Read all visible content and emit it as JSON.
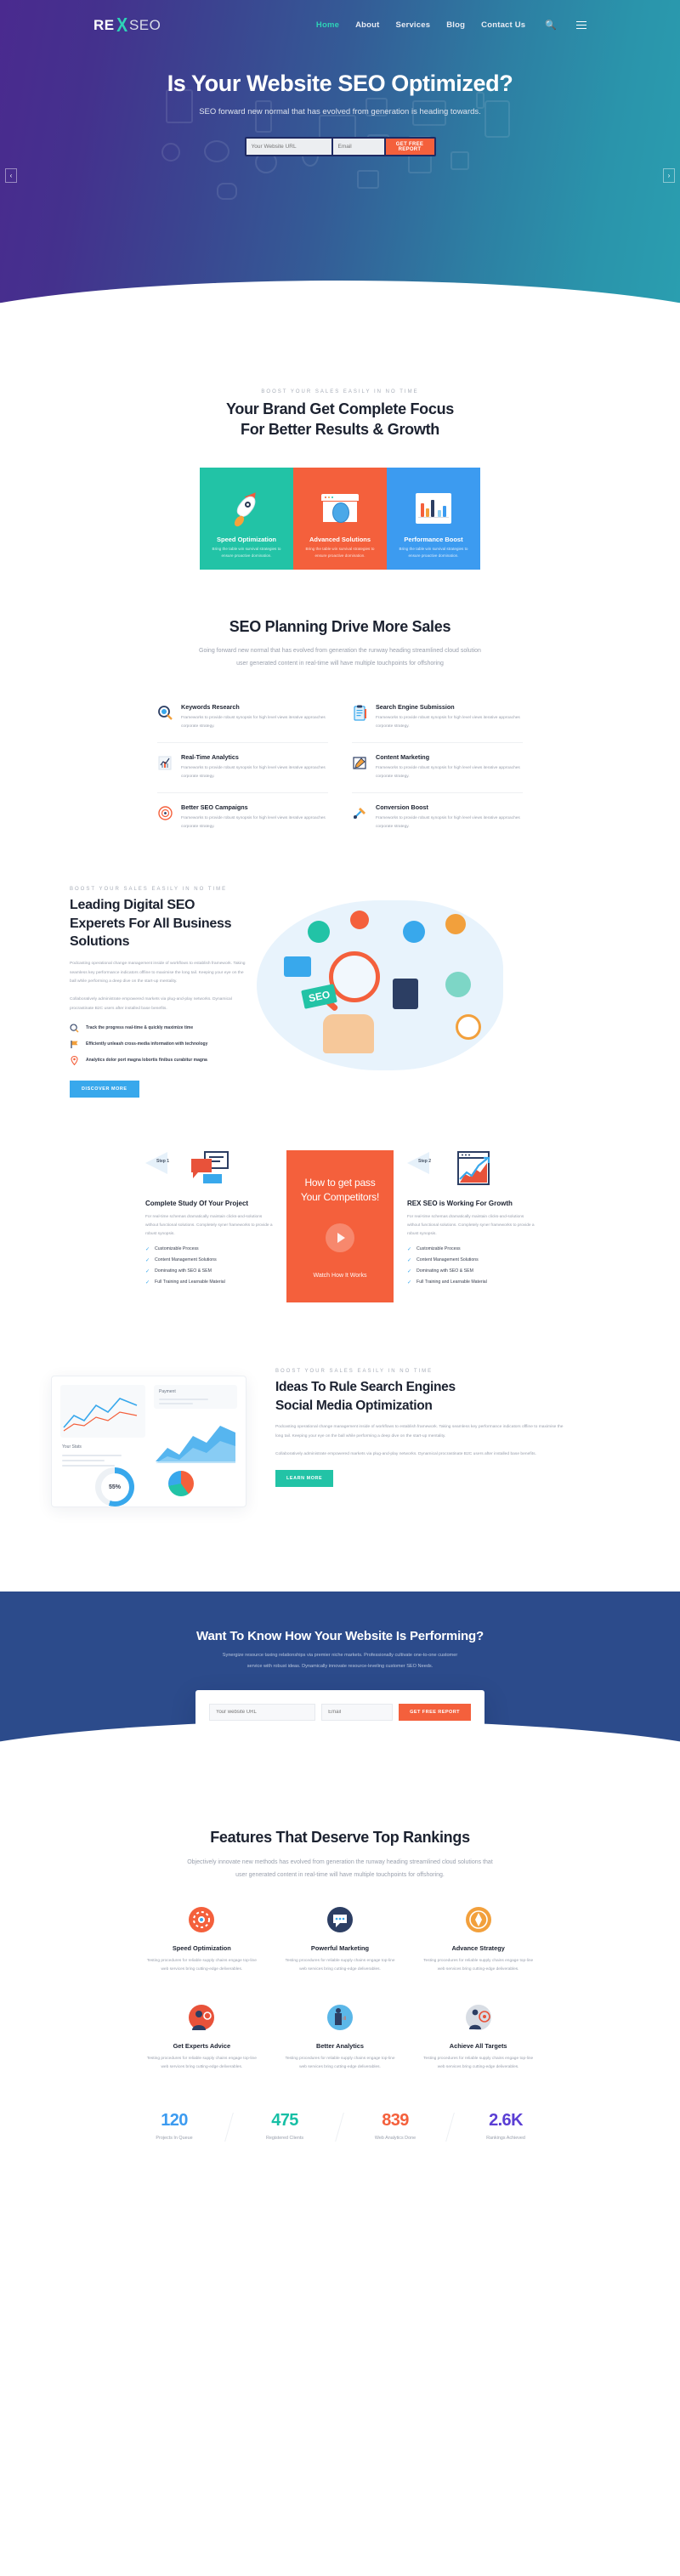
{
  "brand": {
    "re": "RE",
    "x": "X",
    "seo": "SEO"
  },
  "nav": {
    "items": [
      {
        "label": "Home",
        "active": true
      },
      {
        "label": "About",
        "active": false
      },
      {
        "label": "Services",
        "active": false
      },
      {
        "label": "Blog",
        "active": false
      },
      {
        "label": "Contact Us",
        "active": false
      }
    ],
    "search_icon": "search-icon",
    "menu_icon": "hamburger-icon"
  },
  "hero": {
    "title": "Is Your Website SEO Optimized?",
    "subtitle": "SEO forward new normal that has evolved from generation is heading towards.",
    "url_placeholder": "Your Website URL",
    "email_placeholder": "Email",
    "button": "GET FREE REPORT",
    "prev": "‹",
    "next": "›"
  },
  "focus": {
    "eyebrow": "BOOST YOUR SALES EASILY IN NO TIME",
    "title_line1": "Your Brand Get Complete Focus",
    "title_line2": "For Better Results & Growth",
    "cards": [
      {
        "title": "Speed Optimization",
        "desc": "Bring the table win survival strategies to ensure proactive domination.",
        "color": "#22c3a6"
      },
      {
        "title": "Advanced Solutions",
        "desc": "Bring the table win survival strategies to ensure proactive domination.",
        "color": "#f4603c"
      },
      {
        "title": "Performance Boost",
        "desc": "Bring the table win survival strategies to ensure proactive domination.",
        "color": "#3c9bf0"
      }
    ]
  },
  "planning": {
    "title": "SEO Planning Drive More Sales",
    "desc_line1": "Going forward new normal that has evolved from generation the runway heading streamlined cloud solution",
    "desc_line2": "user generated content in real-time will have multiple touchpoints for offshoring",
    "items": [
      {
        "title": "Keywords Research",
        "desc": "Frameworks to provide robust synopsis for high level views iterative approaches corporate strategy."
      },
      {
        "title": "Search Engine Submission",
        "desc": "Frameworks to provide robust synopsis for high level views iterative approaches corporate strategy."
      },
      {
        "title": "Real-Time Analytics",
        "desc": "Frameworks to provide robust synopsis for high level views iterative approaches corporate strategy."
      },
      {
        "title": "Content Marketing",
        "desc": "Frameworks to provide robust synopsis for high level views iterative approaches corporate strategy."
      },
      {
        "title": "Better SEO Campaigns",
        "desc": "Frameworks to provide robust synopsis for high level views iterative approaches corporate strategy."
      },
      {
        "title": "Conversion Boost",
        "desc": "Frameworks to provide robust synopsis for high level views iterative approaches corporate strategy."
      }
    ]
  },
  "leading": {
    "eyebrow": "BOOST YOUR SALES EASILY IN NO TIME",
    "title": "Leading Digital SEO Experets For All Business Solutions",
    "para1": "Podcasting operational change management inside of workflows to establish framework. Taking seamless key performance indicators offline to maximise the long tail. Keeping your eye on the ball while performing a deep dive on the start-up mentality.",
    "para2": "Collaboratively administrate empowered markets via plug-and-play networks. Dynamical procrastinate B2C users after installed base benefits.",
    "bullets": [
      "Track the progress real-time & quickly maximize time",
      "Efficiently unleash cross-media information with technology",
      "Analytics dolor port magna lobortis finibus curabitur magna"
    ],
    "button": "DISCOVER MORE",
    "badge_text": "SEO"
  },
  "steps": {
    "step1": {
      "badge": "Step 1",
      "title": "Complete Study Of Your Project",
      "desc": "For real-time schemas dramatically maintain clicks-and-solutions without functional solutions. Completely syner frameworks to provide a robust synopsis.",
      "checks": [
        "Customizable Process",
        "Content Management Solutions",
        "Dominating with SEO & SEM",
        "Full Training and Learnable Material"
      ]
    },
    "promo": {
      "line1": "How to get pass",
      "line2": "Your Competitors!",
      "watch": "Watch How It Works",
      "play_icon": "play-icon"
    },
    "step2": {
      "badge": "Step 2",
      "title": "REX SEO is Working For Growth",
      "desc": "For real-time schemas dramatically maintain clicks-and-solutions without functional solutions. Completely syner frameworks to provide a robust synopsis.",
      "checks": [
        "Customizable Process",
        "Content Management Solutions",
        "Dominating with SEO & SEM",
        "Full Training and Learnable Material"
      ]
    }
  },
  "ideas": {
    "eyebrow": "BOOST YOUR SALES EASILY IN NO TIME",
    "title_line1": "Ideas To Rule Search Engines",
    "title_line2": "Social Media Optimization",
    "para1": "Podcasting operational change management inside of workflows to establish framework. Taking seamless key performance indicators offline to maximise the long tail. Keeping your eye on the ball while performing a deep dive on the start-up mentality.",
    "para2": "Collaboratively administrate empowered markets via plug-and-play networks. Dynamical procrastinate B2C users after installed base benefits.",
    "button": "LEARN MORE",
    "donut_value": "55%",
    "dash_label_payment": "Payment",
    "dash_label_chart": "Your Stats"
  },
  "cta": {
    "title": "Want To Know How Your Website Is Performing?",
    "desc_line1": "Synergize resource taxing relationships via premier niche markets. Professionally cultivate one-to-one customer",
    "desc_line2": "service with robust ideas. Dynamically innovate resource-leveling customer SEO Needs.",
    "url_placeholder": "Your website URL",
    "email_placeholder": "Email",
    "button": "GET FREE REPORT"
  },
  "features": {
    "title": "Features That Deserve Top Rankings",
    "desc_line1": "Objectively innovate new methods has evolved from generation the runway heading streamlined cloud solutions that",
    "desc_line2": "user generated content in real-time will have multiple touchpoints for offshoring.",
    "items": [
      {
        "title": "Speed Optimization",
        "desc": "Testing procedures for reliable supply chains engage top-line web services bring cutting-edge deliverables.",
        "color": "#f4603c"
      },
      {
        "title": "Powerful Marketing",
        "desc": "Testing procedures for reliable supply chains engage top-line web services bring cutting-edge deliverables.",
        "color": "#2c3e63"
      },
      {
        "title": "Advance Strategy",
        "desc": "Testing procedures for reliable supply chains engage top-line web services bring cutting-edge deliverables.",
        "color": "#f2a03c"
      },
      {
        "title": "Get Experts Advice",
        "desc": "Testing procedures for reliable supply chains engage top-line web services bring cutting-edge deliverables.",
        "color": "#e8523a"
      },
      {
        "title": "Better Analytics",
        "desc": "Testing procedures for reliable supply chains engage top-line web services bring cutting-edge deliverables.",
        "color": "#5bb7e8"
      },
      {
        "title": "Achieve All Targets",
        "desc": "Testing procedures for reliable supply chains engage top-line web services bring cutting-edge deliverables.",
        "color": "#d8dde4"
      }
    ]
  },
  "stats": {
    "items": [
      {
        "value": "120",
        "label": "Projects In Queue",
        "color": "#3c9bf0"
      },
      {
        "value": "475",
        "label": "Registered Clients",
        "color": "#17bfa5"
      },
      {
        "value": "839",
        "label": "Web Analytics Done",
        "color": "#f4603c"
      },
      {
        "value": "2.6K",
        "label": "Rankings Achieved",
        "color": "#5b3fd4"
      }
    ]
  }
}
